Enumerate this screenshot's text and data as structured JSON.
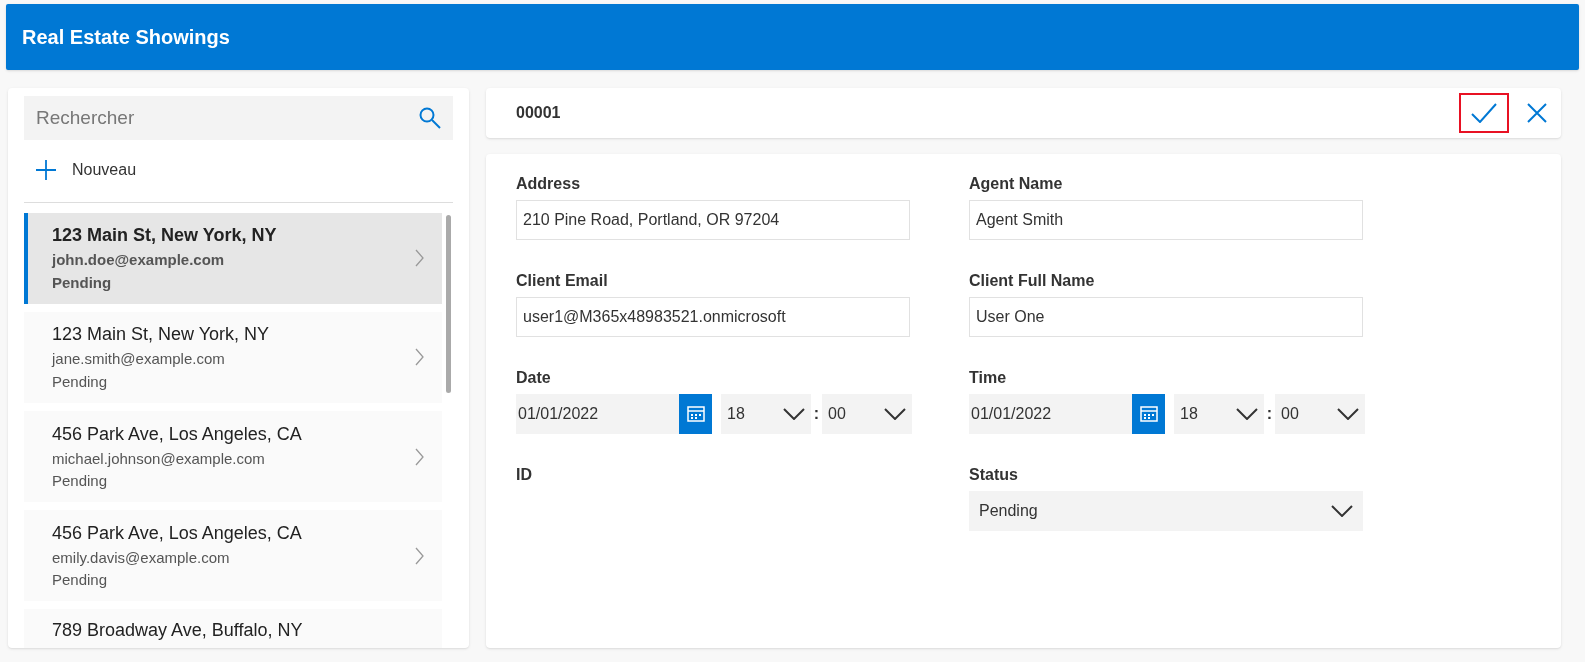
{
  "header": {
    "title": "Real Estate Showings"
  },
  "sidebar": {
    "search": {
      "placeholder": "Rechercher"
    },
    "new_button": {
      "label": "Nouveau"
    },
    "items": [
      {
        "address": "123 Main St, New York, NY",
        "email": "john.doe@example.com",
        "status": "Pending",
        "selected": true
      },
      {
        "address": "123 Main St, New York, NY",
        "email": "jane.smith@example.com",
        "status": "Pending",
        "selected": false
      },
      {
        "address": "456 Park Ave, Los Angeles, CA",
        "email": "michael.johnson@example.com",
        "status": "Pending",
        "selected": false
      },
      {
        "address": "456 Park Ave, Los Angeles, CA",
        "email": "emily.davis@example.com",
        "status": "Pending",
        "selected": false
      },
      {
        "address": "789 Broadway Ave, Buffalo, NY",
        "selected": false
      }
    ]
  },
  "record": {
    "id": "00001",
    "save_button": {
      "highlighted": true
    }
  },
  "form": {
    "fields": [
      {
        "kind": "text",
        "label": "Address",
        "value": "210 Pine Road, Portland, OR 97204"
      },
      {
        "kind": "text",
        "label": "Agent Name",
        "value": "Agent Smith"
      },
      {
        "kind": "text",
        "label": "Client Email",
        "value": "user1@M365x48983521.onmicrosoft"
      },
      {
        "kind": "text",
        "label": "Client Full Name",
        "value": "User One"
      },
      {
        "kind": "datetime",
        "label": "Date",
        "date": "01/01/2022",
        "hour": "18",
        "separator": ":",
        "minute": "00"
      },
      {
        "kind": "datetime",
        "label": "Time",
        "date": "01/01/2022",
        "hour": "18",
        "separator": ":",
        "minute": "00"
      },
      {
        "kind": "empty",
        "label": "ID"
      },
      {
        "kind": "select",
        "label": "Status",
        "value": "Pending"
      }
    ]
  }
}
